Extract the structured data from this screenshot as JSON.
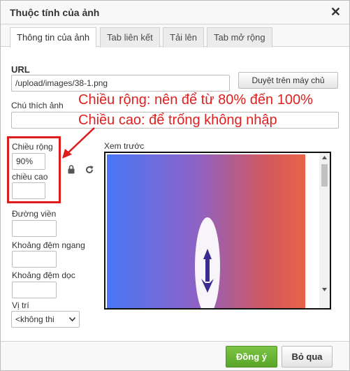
{
  "dialog": {
    "title": "Thuộc tính của ảnh",
    "close_symbol": "✕"
  },
  "tabs": [
    {
      "label": "Thông tin của ảnh",
      "active": true
    },
    {
      "label": "Tab liên kết",
      "active": false
    },
    {
      "label": "Tải lên",
      "active": false
    },
    {
      "label": "Tab mở rộng",
      "active": false
    }
  ],
  "url": {
    "label": "URL",
    "value": "/upload/images/38-1.png",
    "browse_button": "Duyệt trên máy chủ"
  },
  "alt": {
    "label": "Chú thích ảnh",
    "value": ""
  },
  "annotations": {
    "width_note": "Chiều rộng: nên để từ 80% đến 100%",
    "height_note": "Chiều cao: để trống không nhập",
    "color": "#e02020"
  },
  "width": {
    "label": "Chiều rộng",
    "value": "90%"
  },
  "height": {
    "label": "chiều cao",
    "value": ""
  },
  "icons": {
    "lock": "lock-icon",
    "reset": "reset-icon"
  },
  "preview": {
    "label": "Xem trước"
  },
  "border": {
    "label": "Đường viền",
    "value": ""
  },
  "hspace": {
    "label": "Khoảng đệm ngang",
    "value": ""
  },
  "vspace": {
    "label": "Khoảng đệm dọc",
    "value": ""
  },
  "align": {
    "label": "Vị trí",
    "selected": "<không thi"
  },
  "footer": {
    "ok": "Đồng ý",
    "cancel": "Bỏ qua"
  },
  "colors": {
    "ok_button": "#6cb538",
    "highlight": "#e01b1b"
  }
}
